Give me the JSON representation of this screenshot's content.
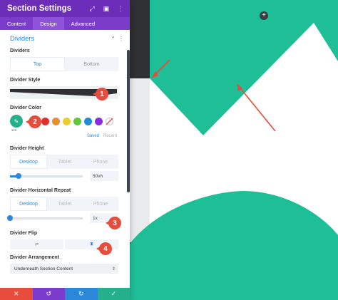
{
  "header": {
    "title": "Section Settings"
  },
  "tabs": [
    {
      "label": "Content"
    },
    {
      "label": "Design"
    },
    {
      "label": "Advanced"
    }
  ],
  "section": {
    "title": "Dividers"
  },
  "dividers": {
    "label": "Dividers",
    "options": [
      "Top",
      "Bottom"
    ],
    "selected": "Top"
  },
  "divider_style": {
    "label": "Divider Style"
  },
  "divider_color": {
    "label": "Divider Color",
    "swatches": [
      "#e0302b",
      "#e8912c",
      "#e9cf2c",
      "#5fc93a",
      "#1f8ad8",
      "#8b2be0"
    ],
    "tabs": [
      "Saved",
      "Recent"
    ]
  },
  "divider_height": {
    "label": "Divider Height",
    "devices": [
      "Desktop",
      "Tablet",
      "Phone"
    ],
    "value": "50vh",
    "slider_fraction": 0.12
  },
  "divider_repeat": {
    "label": "Divider Horizontal Repeat",
    "devices": [
      "Desktop",
      "Tablet",
      "Phone"
    ],
    "value": "1x",
    "slider_fraction": 0.0
  },
  "divider_flip": {
    "label": "Divider Flip",
    "options": [
      "⇄",
      "⧗"
    ]
  },
  "divider_arrangement": {
    "label": "Divider Arrangement",
    "value": "Underneath Section Content"
  },
  "callouts": [
    "1",
    "2",
    "3",
    "4"
  ],
  "colors": {
    "header": "#6c2eb9",
    "accent": "#2b87da",
    "canvas_green": "#1ebe96",
    "callout": "#e74c3c",
    "footer": [
      "#e74c3c",
      "#7b3ccc",
      "#2b87da",
      "#23b08a"
    ]
  },
  "icons": [
    "expand-icon",
    "sidebar-icon",
    "more-icon",
    "chevron-up-icon",
    "more-icon",
    "eyedropper-icon",
    "add-section-icon",
    "close-icon",
    "undo-icon",
    "redo-icon",
    "check-icon"
  ]
}
